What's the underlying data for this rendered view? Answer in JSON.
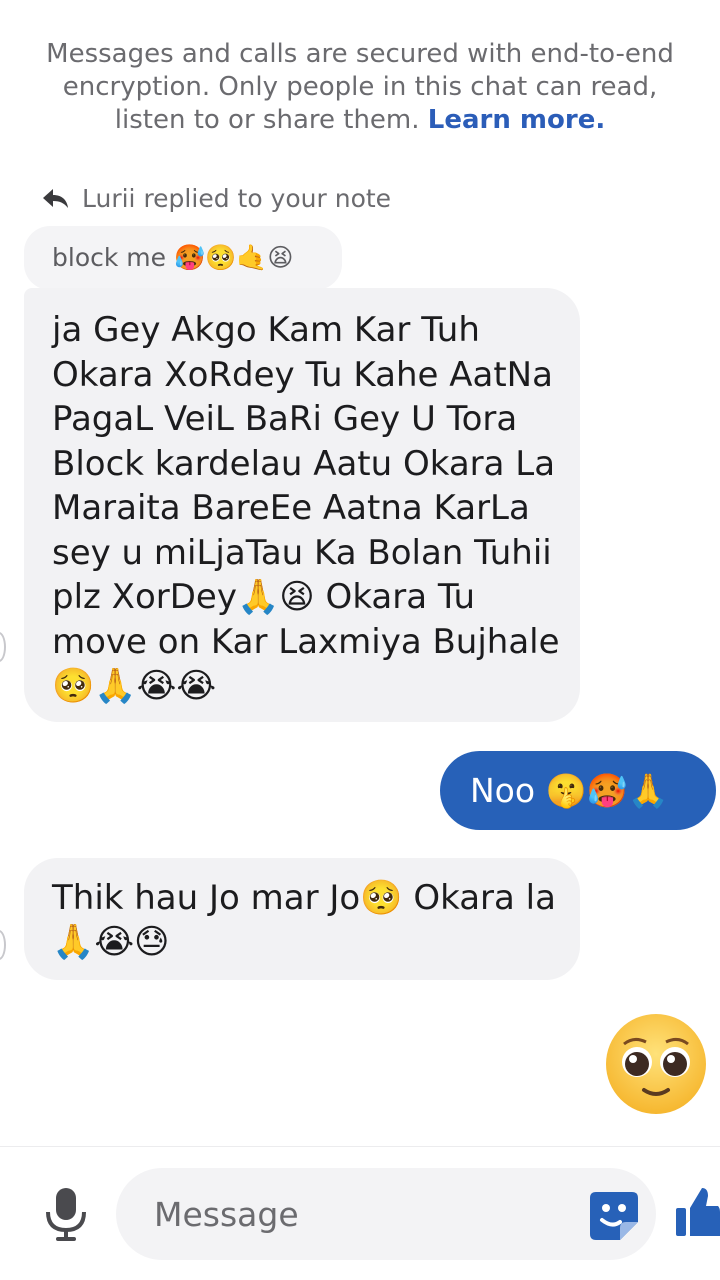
{
  "encryption_notice": {
    "text": "Messages and calls are secured with end-to-end encryption. Only people in this chat can read, listen to or share them.",
    "link": "Learn more."
  },
  "reply_context": {
    "label": "Lurii replied to your note",
    "quoted_note": "block me 🥵🥺🤙😫"
  },
  "messages": [
    {
      "direction": "incoming",
      "text": "ja Gey Akgo Kam Kar Tuh Okara XoRdey Tu Kahe AatNa PagaL VeiL BaRi Gey U Tora Block kardelau Aatu Okara La Maraita BareEe Aatna KarLa sey u miLjaTau Ka Bolan Tuhii plz XorDey🙏😫 Okara Tu move on Kar Laxmiya Bujhale 🥺🙏😭😭"
    },
    {
      "direction": "outgoing",
      "text": "Noo 🤫🥵🙏"
    },
    {
      "direction": "incoming",
      "text": "Thik hau Jo mar Jo🥺 Okara la 🙏😭😓"
    },
    {
      "direction": "outgoing",
      "emoji": "pleading-face"
    }
  ],
  "composer": {
    "placeholder": "Message"
  },
  "icons": {
    "mic": "microphone-icon",
    "sticker": "sticker-icon",
    "like": "thumbs-up-icon",
    "reply": "reply-arrow-icon"
  },
  "colors": {
    "accent": "#2761b8",
    "link": "#2b5db8",
    "incoming_bubble": "#f2f2f4"
  }
}
